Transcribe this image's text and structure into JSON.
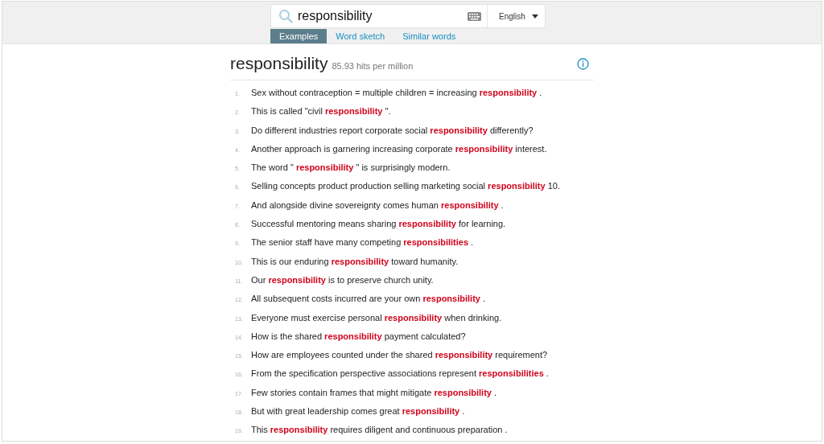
{
  "search": {
    "value": "responsibility",
    "language": "English"
  },
  "tabs": [
    {
      "label": "Examples",
      "selected": true
    },
    {
      "label": "Word sketch",
      "selected": false
    },
    {
      "label": "Similar words",
      "selected": false
    }
  ],
  "heading": {
    "word": "responsibility",
    "frequency": "85.93 hits per million"
  },
  "examples": [
    {
      "number": "1.",
      "text": "Sex without contraception = multiple children = increasing **responsibility** ."
    },
    {
      "number": "2.",
      "text": "This is called \"civil **responsibility** \"."
    },
    {
      "number": "3.",
      "text": "Do different industries report corporate social **responsibility** differently?"
    },
    {
      "number": "4.",
      "text": "Another approach is garnering increasing corporate **responsibility** interest."
    },
    {
      "number": "5.",
      "text": "The word \" **responsibility** \" is surprisingly modern."
    },
    {
      "number": "6.",
      "text": "Selling concepts product production selling marketing social **responsibility** 10."
    },
    {
      "number": "7.",
      "text": "And alongside divine sovereignty comes human **responsibility** ."
    },
    {
      "number": "8.",
      "text": "Successful mentoring means sharing **responsibility** for learning."
    },
    {
      "number": "9.",
      "text": "The senior staff have many competing **responsibilities** ."
    },
    {
      "number": "10.",
      "text": "This is our enduring **responsibility** toward humanity."
    },
    {
      "number": "11.",
      "text": "Our **responsibility** is to preserve church unity."
    },
    {
      "number": "12.",
      "text": "All subsequent costs incurred are your own **responsibility** ."
    },
    {
      "number": "13.",
      "text": "Everyone must exercise personal **responsibility** when drinking."
    },
    {
      "number": "14.",
      "text": "How is the shared **responsibility** payment calculated?"
    },
    {
      "number": "15.",
      "text": "How are employees counted under the shared **responsibility** requirement?"
    },
    {
      "number": "16.",
      "text": "From the specification perspective associations represent **responsibilities** ."
    },
    {
      "number": "17.",
      "text": "Few stories contain frames that might mitigate **responsibility** ."
    },
    {
      "number": "18.",
      "text": "But with great leadership comes great **responsibility** ."
    },
    {
      "number": "19.",
      "text": "This **responsibility** requires diligent and continuous preparation ."
    }
  ]
}
